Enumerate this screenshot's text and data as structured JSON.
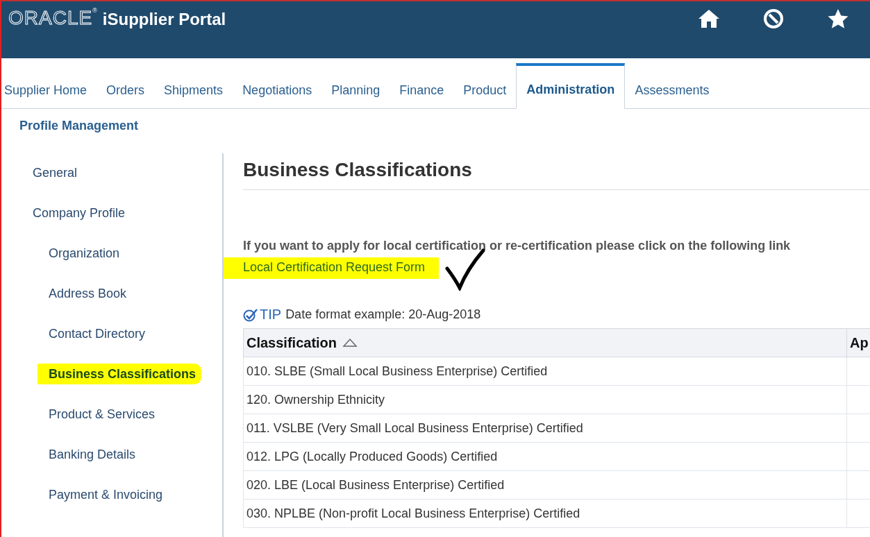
{
  "header": {
    "logo": "ORACLE",
    "logo_mark": "®",
    "title": "iSupplier Portal"
  },
  "tabs": [
    {
      "label": "Supplier Home",
      "selected": false
    },
    {
      "label": "Orders",
      "selected": false
    },
    {
      "label": "Shipments",
      "selected": false
    },
    {
      "label": "Negotiations",
      "selected": false
    },
    {
      "label": "Planning",
      "selected": false
    },
    {
      "label": "Finance",
      "selected": false
    },
    {
      "label": "Product",
      "selected": false
    },
    {
      "label": "Administration",
      "selected": true
    },
    {
      "label": "Assessments",
      "selected": false
    }
  ],
  "subtab": "Profile Management",
  "sidebar": {
    "items": [
      {
        "label": "General",
        "selected": false
      },
      {
        "label": "Company Profile",
        "selected": false,
        "children": [
          {
            "label": "Organization",
            "selected": false
          },
          {
            "label": "Address Book",
            "selected": false
          },
          {
            "label": "Contact Directory",
            "selected": false
          },
          {
            "label": "Business Classifications",
            "selected": true
          },
          {
            "label": "Product & Services",
            "selected": false
          },
          {
            "label": "Banking Details",
            "selected": false
          },
          {
            "label": "Payment & Invoicing",
            "selected": false
          }
        ]
      }
    ]
  },
  "page_title": "Business Classifications",
  "instruction": "If you want to apply for local certification or re-certification please click on the following link",
  "link": {
    "label": "Local Certification Request Form",
    "highlighted": true
  },
  "tip": {
    "label": "TIP",
    "text": "Date format example: 20-Aug-2018"
  },
  "table": {
    "columns": [
      "Classification",
      "Ap"
    ],
    "rows": [
      [
        "010. SLBE (Small Local Business Enterprise) Certified"
      ],
      [
        "120. Ownership Ethnicity"
      ],
      [
        "011. VSLBE (Very Small Local Business Enterprise) Certified"
      ],
      [
        "012. LPG (Locally Produced Goods) Certified"
      ],
      [
        "020. LBE (Local Business Enterprise) Certified"
      ],
      [
        "030. NPLBE (Non-profit Local Business Enterprise) Certified"
      ]
    ]
  }
}
